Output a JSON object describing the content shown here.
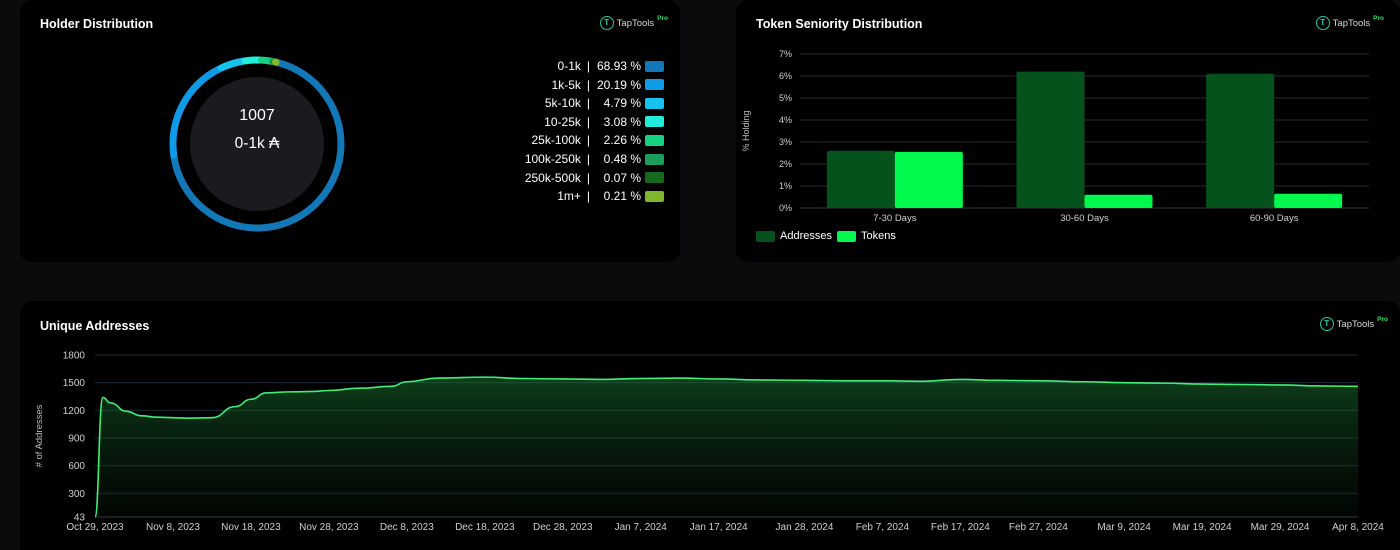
{
  "holder": {
    "title": "Holder Distribution",
    "brand": "TapTools",
    "brand_badge": "Pro",
    "center_value": "1007",
    "center_label": "0-1k ₳",
    "legend": [
      {
        "range": "0-1k",
        "pct": "68.93 %",
        "color": "#1378b8"
      },
      {
        "range": "1k-5k",
        "pct": "20.19 %",
        "color": "#0f9ae6"
      },
      {
        "range": "5k-10k",
        "pct": "4.79 %",
        "color": "#16c3ef"
      },
      {
        "range": "10-25k",
        "pct": "3.08 %",
        "color": "#21edda"
      },
      {
        "range": "25k-100k",
        "pct": "2.26 %",
        "color": "#17d183"
      },
      {
        "range": "100k-250k",
        "pct": "0.48 %",
        "color": "#1b9e5c"
      },
      {
        "range": "250k-500k",
        "pct": "0.07 %",
        "color": "#15691d"
      },
      {
        "range": "1m+",
        "pct": "0.21 %",
        "color": "#7fb72e"
      }
    ]
  },
  "seniority": {
    "title": "Token Seniority Distribution",
    "brand": "TapTools",
    "brand_badge": "Pro",
    "legend_addresses": "Addresses",
    "legend_tokens": "Tokens"
  },
  "unique": {
    "title": "Unique Addresses",
    "brand": "TapTools",
    "brand_badge": "Pro"
  },
  "chart_data": [
    {
      "type": "pie",
      "title": "Holder Distribution",
      "categories": [
        "0-1k",
        "1k-5k",
        "5k-10k",
        "10-25k",
        "25k-100k",
        "100k-250k",
        "250k-500k",
        "1m+"
      ],
      "values": [
        68.93,
        20.19,
        4.79,
        3.08,
        2.26,
        0.48,
        0.07,
        0.21
      ],
      "colors": [
        "#1378b8",
        "#0f9ae6",
        "#16c3ef",
        "#21edda",
        "#17d183",
        "#1b9e5c",
        "#15691d",
        "#7fb72e"
      ]
    },
    {
      "type": "bar",
      "title": "Token Seniority Distribution",
      "categories": [
        "7-30 Days",
        "30-60 Days",
        "60-90 Days"
      ],
      "series": [
        {
          "name": "Addresses",
          "values": [
            2.6,
            6.2,
            6.1
          ],
          "color": "#06521c"
        },
        {
          "name": "Tokens",
          "values": [
            2.55,
            0.6,
            0.65
          ],
          "color": "#00f94c"
        }
      ],
      "xlabel": "",
      "ylabel": "% Holding",
      "yticks": [
        "0%",
        "1%",
        "2%",
        "3%",
        "4%",
        "5%",
        "6%",
        "7%"
      ],
      "ylim": [
        0,
        7
      ],
      "grid": true,
      "legend": "bottom-left"
    },
    {
      "type": "area",
      "title": "Unique Addresses",
      "xlabel": "",
      "ylabel": "# of Addresses",
      "yticks": [
        43,
        300,
        600,
        900,
        1200,
        1500,
        1800
      ],
      "ylim": [
        43,
        1800
      ],
      "xticks": [
        "Oct 29, 2023",
        "Nov 8, 2023",
        "Nov 18, 2023",
        "Nov 28, 2023",
        "Dec 8, 2023",
        "Dec 18, 2023",
        "Dec 28, 2023",
        "Jan 7, 2024",
        "Jan 17, 2024",
        "Jan 28, 2024",
        "Feb 7, 2024",
        "Feb 17, 2024",
        "Feb 27, 2024",
        "Mar 9, 2024",
        "Mar 19, 2024",
        "Mar 29, 2024",
        "Apr 8, 2024"
      ],
      "x": [
        "Oct 29, 2023",
        "Oct 30, 2023",
        "Oct 31, 2023",
        "Nov 2, 2023",
        "Nov 4, 2023",
        "Nov 6, 2023",
        "Nov 8, 2023",
        "Nov 10, 2023",
        "Nov 13, 2023",
        "Nov 16, 2023",
        "Nov 18, 2023",
        "Nov 20, 2023",
        "Nov 23, 2023",
        "Nov 26, 2023",
        "Nov 28, 2023",
        "Dec 2, 2023",
        "Dec 6, 2023",
        "Dec 8, 2023",
        "Dec 12, 2023",
        "Dec 18, 2023",
        "Dec 23, 2023",
        "Dec 28, 2023",
        "Jan 2, 2024",
        "Jan 7, 2024",
        "Jan 12, 2024",
        "Jan 17, 2024",
        "Jan 22, 2024",
        "Jan 28, 2024",
        "Feb 2, 2024",
        "Feb 7, 2024",
        "Feb 12, 2024",
        "Feb 17, 2024",
        "Feb 22, 2024",
        "Feb 27, 2024",
        "Mar 4, 2024",
        "Mar 9, 2024",
        "Mar 14, 2024",
        "Mar 19, 2024",
        "Mar 24, 2024",
        "Mar 29, 2024",
        "Apr 3, 2024",
        "Apr 8, 2024"
      ],
      "series": [
        {
          "name": "",
          "values": [
            43,
            1340,
            1280,
            1190,
            1140,
            1125,
            1120,
            1115,
            1120,
            1240,
            1320,
            1390,
            1400,
            1405,
            1415,
            1440,
            1460,
            1510,
            1550,
            1560,
            1545,
            1540,
            1535,
            1545,
            1550,
            1540,
            1530,
            1525,
            1520,
            1520,
            1515,
            1535,
            1525,
            1520,
            1510,
            1500,
            1495,
            1485,
            1480,
            1475,
            1465,
            1460
          ]
        }
      ],
      "grid": true
    }
  ]
}
